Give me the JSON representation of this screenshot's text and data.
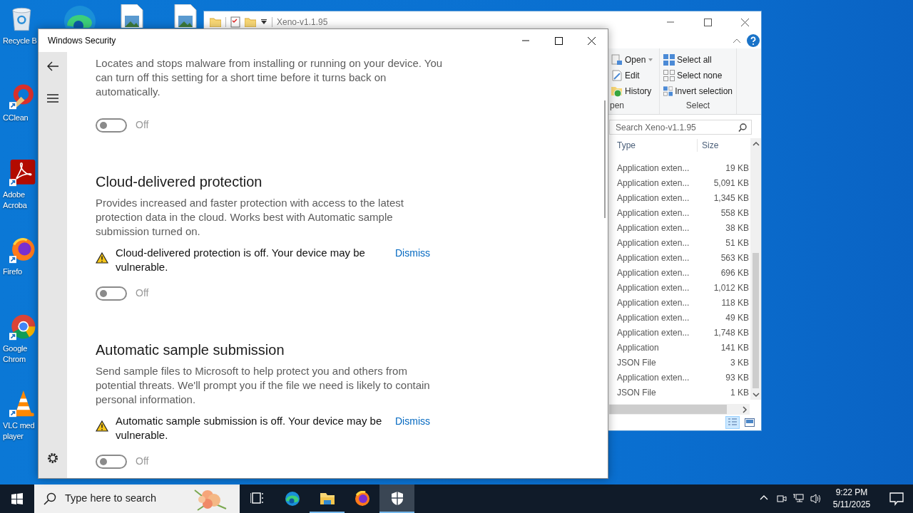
{
  "desktop_icons": [
    {
      "kind": "recycle",
      "label": "Recycle B"
    },
    {
      "kind": "cleaner",
      "label": "CClean"
    },
    {
      "kind": "pdf",
      "label": "Adobe\nAcroba"
    },
    {
      "kind": "fox",
      "label": "Firefo"
    },
    {
      "kind": "chrome",
      "label": "Google\nChrom"
    },
    {
      "kind": "cone",
      "label": "VLC med\nplayer"
    }
  ],
  "top_icons": [
    {
      "kind": "edge"
    },
    {
      "kind": "image-file"
    },
    {
      "kind": "image-file"
    }
  ],
  "explorer": {
    "title": "Xeno-v1.1.95",
    "ribbon": {
      "groups": [
        {
          "label": "pen",
          "items": [
            {
              "kind": "open",
              "label": "Open",
              "has_menu": true
            },
            {
              "kind": "edit",
              "label": "Edit",
              "has_menu": false
            },
            {
              "kind": "history",
              "label": "History",
              "has_menu": false
            }
          ]
        },
        {
          "label": "Select",
          "items": [
            {
              "kind": "select-all",
              "label": "Select all",
              "has_menu": false
            },
            {
              "kind": "select-none",
              "label": "Select none",
              "has_menu": false
            },
            {
              "kind": "invert",
              "label": "Invert selection",
              "has_menu": false
            }
          ]
        }
      ]
    },
    "search": {
      "placeholder": "Search Xeno-v1.1.95"
    },
    "columns": [
      "Type",
      "Size"
    ],
    "rows": [
      {
        "type": "Application exten...",
        "size": "19 KB"
      },
      {
        "type": "Application exten...",
        "size": "5,091 KB"
      },
      {
        "type": "Application exten...",
        "size": "1,345 KB"
      },
      {
        "type": "Application exten...",
        "size": "558 KB"
      },
      {
        "type": "Application exten...",
        "size": "38 KB"
      },
      {
        "type": "Application exten...",
        "size": "51 KB"
      },
      {
        "type": "Application exten...",
        "size": "563 KB"
      },
      {
        "type": "Application exten...",
        "size": "696 KB"
      },
      {
        "type": "Application exten...",
        "size": "1,012 KB"
      },
      {
        "type": "Application exten...",
        "size": "118 KB"
      },
      {
        "type": "Application exten...",
        "size": "49 KB"
      },
      {
        "type": "Application exten...",
        "size": "1,748 KB"
      },
      {
        "type": "Application",
        "size": "141 KB"
      },
      {
        "type": "JSON File",
        "size": "3 KB"
      },
      {
        "type": "Application exten...",
        "size": "93 KB"
      },
      {
        "type": "JSON File",
        "size": "1 KB"
      }
    ]
  },
  "security": {
    "title": "Windows Security",
    "sections": [
      {
        "description": "Locates and stops malware from installing or running on your device. You can turn off this setting for a short time before it turns back on automatically.",
        "toggle": {
          "on": false,
          "disabled": true,
          "label": "Off"
        }
      },
      {
        "heading": "Cloud-delivered protection",
        "description": "Provides increased and faster protection with access to the latest protection data in the cloud. Works best with Automatic sample submission turned on.",
        "warning": {
          "text": "Cloud-delivered protection is off. Your device may be vulnerable.",
          "action": "Dismiss"
        },
        "toggle": {
          "on": false,
          "disabled": true,
          "label": "Off"
        }
      },
      {
        "heading": "Automatic sample submission",
        "description": "Send sample files to Microsoft to help protect you and others from potential threats. We'll prompt you if the file we need is likely to contain personal information.",
        "warning": {
          "text": "Automatic sample submission is off. Your device may be vulnerable.",
          "action": "Dismiss"
        },
        "toggle": {
          "on": false,
          "disabled": true,
          "label": "Off"
        }
      }
    ]
  },
  "taskbar": {
    "search": {
      "placeholder": "Type here to search"
    },
    "apps": [
      {
        "kind": "task-view",
        "running": false,
        "selected": false
      },
      {
        "kind": "edge",
        "running": false,
        "selected": false
      },
      {
        "kind": "folder",
        "running": true,
        "selected": false
      },
      {
        "kind": "fox",
        "running": false,
        "selected": false
      },
      {
        "kind": "shield",
        "running": true,
        "selected": true
      }
    ],
    "clock": {
      "time": "9:22 PM",
      "date": "5/11/2025"
    }
  }
}
